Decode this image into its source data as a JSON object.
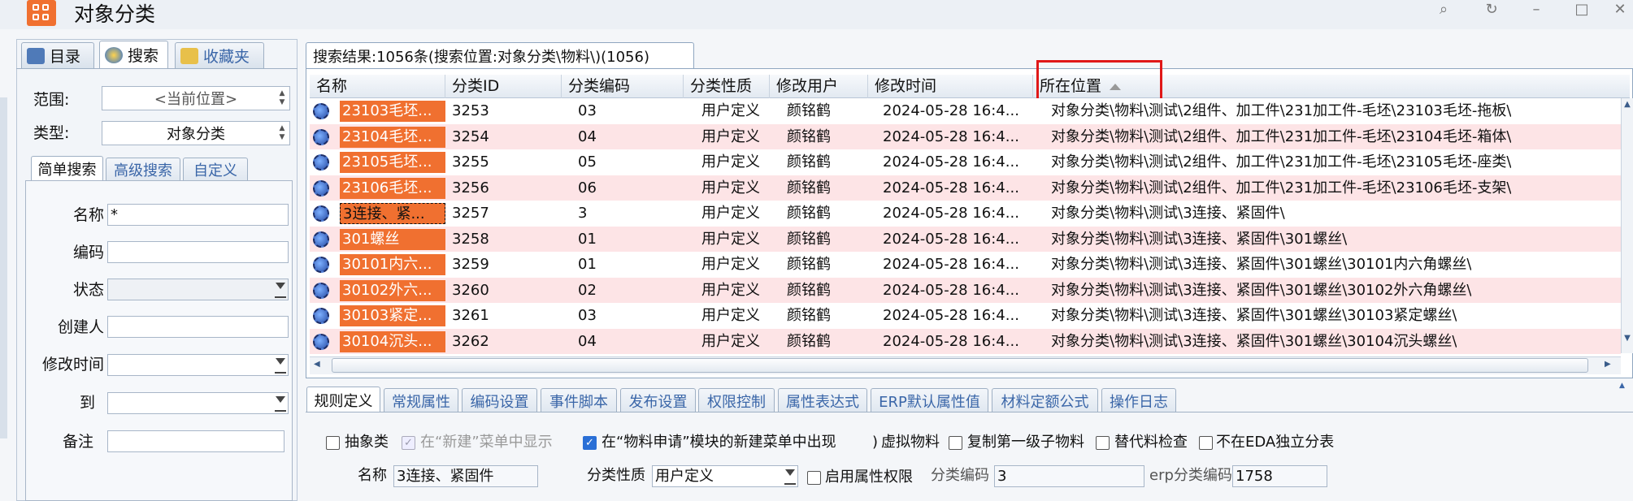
{
  "window": {
    "title": "对象分类"
  },
  "left_tabs": [
    {
      "label": "目录"
    },
    {
      "label": "搜索"
    },
    {
      "label": "收藏夹"
    }
  ],
  "scope": {
    "label": "范围:",
    "value": "<当前位置>"
  },
  "type": {
    "label": "类型:",
    "value": "对象分类"
  },
  "search_tabs": [
    {
      "label": "简单搜索"
    },
    {
      "label": "高级搜索"
    },
    {
      "label": "自定义"
    }
  ],
  "search_fields": {
    "name": {
      "label": "名称",
      "value": "*"
    },
    "code": {
      "label": "编码",
      "value": ""
    },
    "status": {
      "label": "状态",
      "value": ""
    },
    "creator": {
      "label": "创建人",
      "value": ""
    },
    "mod_time": {
      "label": "修改时间",
      "value": ""
    },
    "to": {
      "label": "到",
      "value": ""
    },
    "note": {
      "label": "备注",
      "value": ""
    }
  },
  "results": {
    "tab_label": "搜索结果:1056条(搜索位置:对象分类\\物料\\)(1056)",
    "columns": [
      "名称",
      "分类ID",
      "分类编码",
      "分类性质",
      "修改用户",
      "修改时间",
      "所在位置"
    ],
    "rows": [
      {
        "name": "23103毛坯...",
        "id": "3253",
        "code": "03",
        "nature": "用户定义",
        "user": "颜铭鹤",
        "time": "2024-05-28 16:4...",
        "location": "对象分类\\物料\\测试\\2组件、加工件\\231加工件-毛坯\\23103毛坯-拖板\\"
      },
      {
        "name": "23104毛坯...",
        "id": "3254",
        "code": "04",
        "nature": "用户定义",
        "user": "颜铭鹤",
        "time": "2024-05-28 16:4...",
        "location": "对象分类\\物料\\测试\\2组件、加工件\\231加工件-毛坯\\23104毛坯-箱体\\"
      },
      {
        "name": "23105毛坯...",
        "id": "3255",
        "code": "05",
        "nature": "用户定义",
        "user": "颜铭鹤",
        "time": "2024-05-28 16:4...",
        "location": "对象分类\\物料\\测试\\2组件、加工件\\231加工件-毛坯\\23105毛坯-座类\\"
      },
      {
        "name": "23106毛坯...",
        "id": "3256",
        "code": "06",
        "nature": "用户定义",
        "user": "颜铭鹤",
        "time": "2024-05-28 16:4...",
        "location": "对象分类\\物料\\测试\\2组件、加工件\\231加工件-毛坯\\23106毛坯-支架\\"
      },
      {
        "name": "3连接、紧...",
        "id": "3257",
        "code": "3",
        "nature": "用户定义",
        "user": "颜铭鹤",
        "time": "2024-05-28 16:4...",
        "location": "对象分类\\物料\\测试\\3连接、紧固件\\"
      },
      {
        "name": "301螺丝",
        "id": "3258",
        "code": "01",
        "nature": "用户定义",
        "user": "颜铭鹤",
        "time": "2024-05-28 16:4...",
        "location": "对象分类\\物料\\测试\\3连接、紧固件\\301螺丝\\"
      },
      {
        "name": "30101内六...",
        "id": "3259",
        "code": "01",
        "nature": "用户定义",
        "user": "颜铭鹤",
        "time": "2024-05-28 16:4...",
        "location": "对象分类\\物料\\测试\\3连接、紧固件\\301螺丝\\30101内六角螺丝\\"
      },
      {
        "name": "30102外六...",
        "id": "3260",
        "code": "02",
        "nature": "用户定义",
        "user": "颜铭鹤",
        "time": "2024-05-28 16:4...",
        "location": "对象分类\\物料\\测试\\3连接、紧固件\\301螺丝\\30102外六角螺丝\\"
      },
      {
        "name": "30103紧定...",
        "id": "3261",
        "code": "03",
        "nature": "用户定义",
        "user": "颜铭鹤",
        "time": "2024-05-28 16:4...",
        "location": "对象分类\\物料\\测试\\3连接、紧固件\\301螺丝\\30103紧定螺丝\\"
      },
      {
        "name": "30104沉头...",
        "id": "3262",
        "code": "04",
        "nature": "用户定义",
        "user": "颜铭鹤",
        "time": "2024-05-28 16:4...",
        "location": "对象分类\\物料\\测试\\3连接、紧固件\\301螺丝\\30104沉头螺丝\\"
      }
    ]
  },
  "bottom_tabs": [
    {
      "label": "规则定义"
    },
    {
      "label": "常规属性"
    },
    {
      "label": "编码设置"
    },
    {
      "label": "事件脚本"
    },
    {
      "label": "发布设置"
    },
    {
      "label": "权限控制"
    },
    {
      "label": "属性表达式"
    },
    {
      "label": "ERP默认属性值"
    },
    {
      "label": "材料定额公式"
    },
    {
      "label": "操作日志"
    }
  ],
  "rules": {
    "abstract": "抽象类",
    "new_menu": "在“新建”菜单中显示",
    "in_request": "在“物料申请”模块的新建菜单中出现",
    "virtual": "虚拟物料",
    "copy_first": "复制第一级子物料",
    "substitute": "替代料检查",
    "not_eda": "不在EDA独立分表",
    "name_label": "名称",
    "name_value": "3连接、紧固件",
    "nature_label": "分类性质",
    "nature_value": "用户定义",
    "attr_perm": "启用属性权限",
    "code_label": "分类编码",
    "code_value": "3",
    "erp_label": "erp分类编码",
    "erp_value": "1758"
  }
}
